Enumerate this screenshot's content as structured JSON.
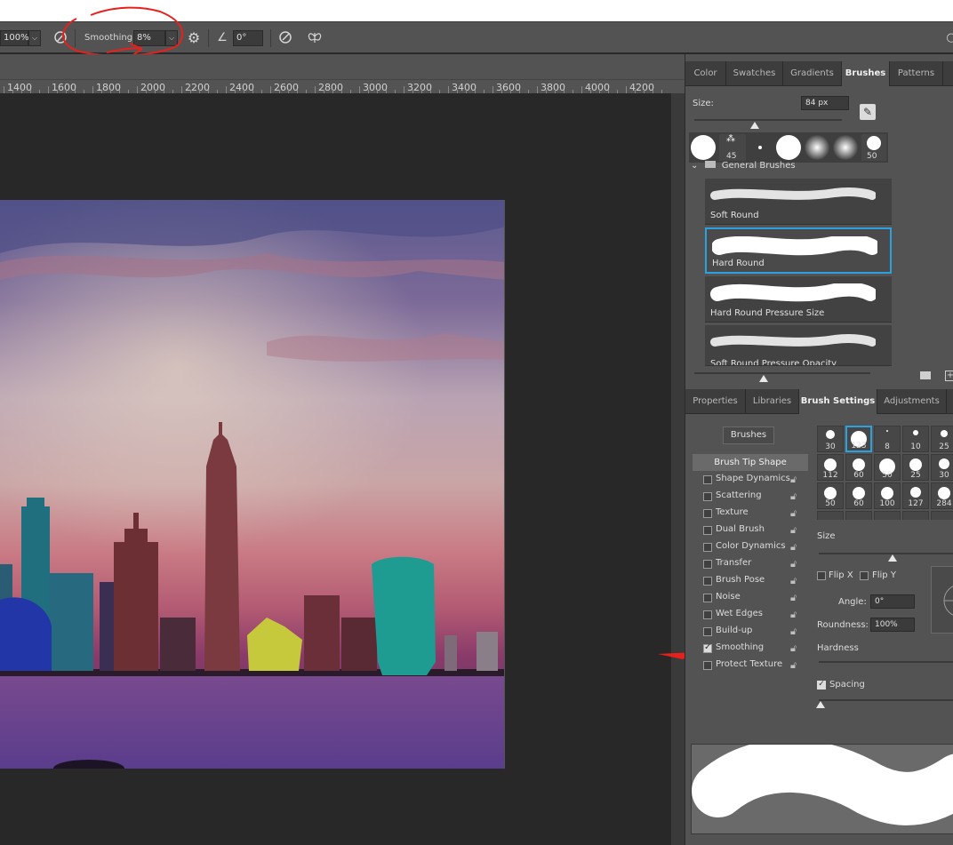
{
  "options_bar": {
    "opacity_value": "100%",
    "smoothing_label": "Smoothing:",
    "smoothing_value": "8%",
    "angle_value": "0°"
  },
  "ruler": {
    "ticks": [
      "1400",
      "1600",
      "1800",
      "2000",
      "2200",
      "2400",
      "2600",
      "2800",
      "3000",
      "3200",
      "3400",
      "3600",
      "3800",
      "4000",
      "4200"
    ]
  },
  "brushes_panel": {
    "tabs": [
      "Color",
      "Swatches",
      "Gradients",
      "Brushes",
      "Patterns"
    ],
    "active_tab": "Brushes",
    "size_label": "Size:",
    "size_value": "84 px",
    "size_fraction": 0.42,
    "recent_numbers": [
      "45",
      "50"
    ],
    "group_name": "General Brushes",
    "brushes": [
      "Soft Round",
      "Hard Round",
      "Hard Round Pressure Size",
      "Soft Round Pressure Opacity"
    ],
    "selected_brush": "Hard Round",
    "preview_fraction": 0.37
  },
  "brush_settings_panel": {
    "tabs": [
      "Properties",
      "Libraries",
      "Brush Settings",
      "Adjustments"
    ],
    "active_tab": "Brush Settings",
    "brushes_button": "Brushes",
    "tip_shape": "Brush Tip Shape",
    "options": [
      {
        "label": "Shape Dynamics",
        "checked": false
      },
      {
        "label": "Scattering",
        "checked": false
      },
      {
        "label": "Texture",
        "checked": false
      },
      {
        "label": "Dual Brush",
        "checked": false
      },
      {
        "label": "Color Dynamics",
        "checked": false
      },
      {
        "label": "Transfer",
        "checked": false
      },
      {
        "label": "Brush Pose",
        "checked": false
      },
      {
        "label": "Noise",
        "checked": false
      },
      {
        "label": "Wet Edges",
        "checked": false
      },
      {
        "label": "Build-up",
        "checked": false
      },
      {
        "label": "Smoothing",
        "checked": true
      },
      {
        "label": "Protect Texture",
        "checked": false
      }
    ],
    "preset_sizes": [
      "30",
      "123",
      "8",
      "10",
      "25",
      "112",
      "60",
      "50",
      "25",
      "30",
      "50",
      "60",
      "100",
      "127",
      "284"
    ],
    "size_label": "Size",
    "flip_x": "Flip X",
    "flip_y": "Flip Y",
    "angle_label": "Angle:",
    "angle_value": "0°",
    "roundness_label": "Roundness:",
    "roundness_value": "100%",
    "hardness_label": "Hardness",
    "spacing_label": "Spacing",
    "spacing_checked": true
  },
  "colors": {
    "accent": "#2ba1e0",
    "annotation": "#e8201c"
  }
}
